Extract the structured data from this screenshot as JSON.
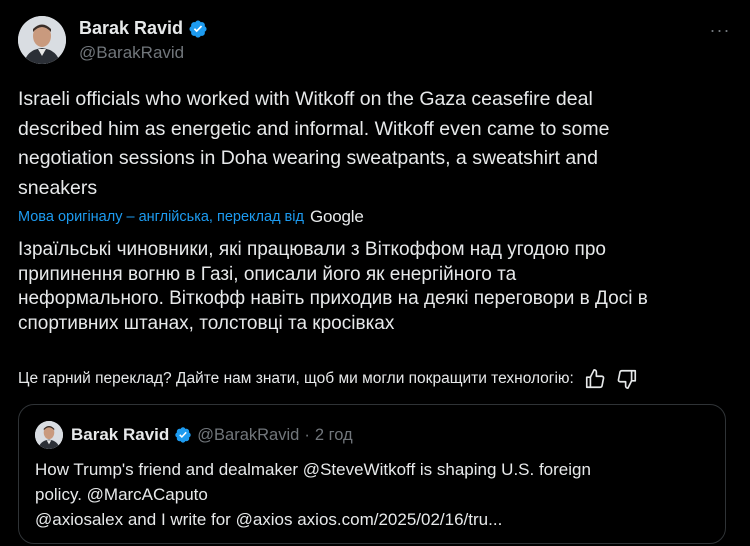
{
  "author": {
    "name": "Barak Ravid",
    "handle": "@BarakRavid"
  },
  "more_icon": "···",
  "tweet": {
    "lines": [
      "Israeli officials who worked with Witkoff on the Gaza ceasefire deal",
      "described him as energetic and informal. Witkoff even came to some",
      "negotiation sessions in Doha wearing sweatpants, a sweatshirt and",
      "sneakers"
    ]
  },
  "translation": {
    "note": "Мова оригіналу – англійська, переклад від",
    "provider": "Google",
    "lines": [
      "Ізраїльські чиновники, які працювали з Віткоффом над угодою про",
      "припинення вогню в Газі, описали його як енергійного та",
      "неформального. Віткофф навіть приходив на деякі переговори в Досі в",
      "спортивних штанах, толстовці та кросівках"
    ],
    "feedback": "Це гарний переклад? Дайте нам знати, щоб ми могли покращити технологію:"
  },
  "quote": {
    "name": "Barak Ravid",
    "handle": "@BarakRavid",
    "separator": "·",
    "time": "2 год",
    "lines": [
      "How Trump's friend and dealmaker @SteveWitkoff is shaping U.S. foreign",
      "policy. @MarcACaputo",
      "@axiosalex and I write for @axios axios.com/2025/02/16/tru..."
    ]
  },
  "colors": {
    "background": "#000000",
    "text": "#e7e9ea",
    "secondary": "#71767b",
    "accent": "#1d9bf0",
    "border": "#2f3336"
  },
  "icons": [
    "verified-badge-icon",
    "more-icon",
    "thumbs-up-icon",
    "thumbs-down-icon"
  ]
}
